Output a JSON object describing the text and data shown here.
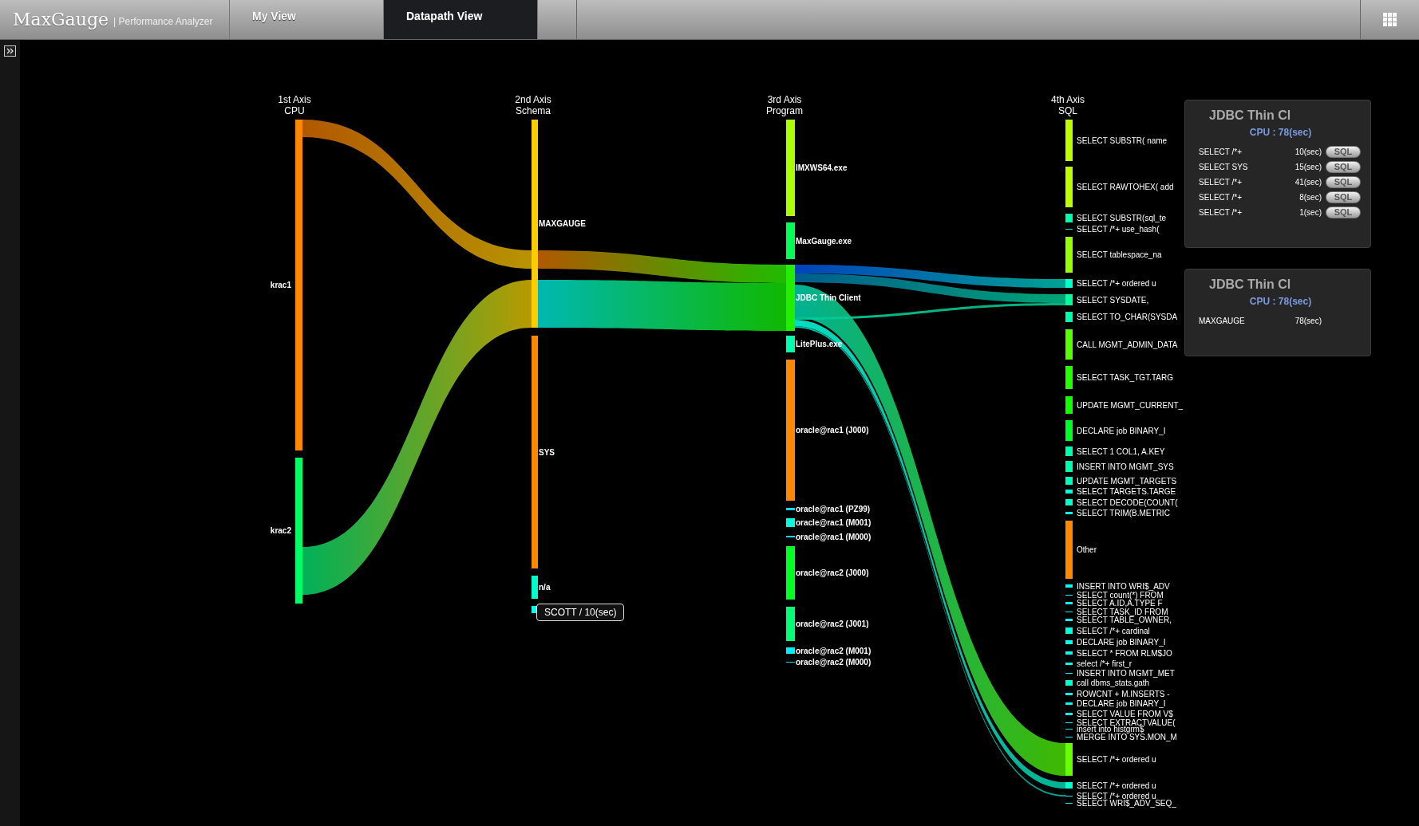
{
  "header": {
    "logo": "MaxGauge",
    "subtitle": "| Performance Analyzer",
    "tabs": [
      {
        "label": "My View",
        "selected": false
      },
      {
        "label": "Datapath View",
        "selected": true
      }
    ]
  },
  "diagram": {
    "axes": [
      {
        "title": "1st Axis",
        "subtitle": "CPU",
        "nodes": [
          {
            "label": "krac1",
            "color": "#ff8800"
          },
          {
            "label": "krac2",
            "color": "#00ff66"
          }
        ]
      },
      {
        "title": "2nd Axis",
        "subtitle": "Schema",
        "nodes": [
          {
            "label": "MAXGAUGE",
            "color": "#ffcc00"
          },
          {
            "label": "SYS",
            "color": "#ff8800"
          },
          {
            "label": "n/a",
            "color": "#00ffcc"
          },
          {
            "color": "#00ffee"
          }
        ]
      },
      {
        "title": "3rd Axis",
        "subtitle": "Program",
        "nodes": [
          {
            "label": "IMXWS64.exe",
            "color": "#aaff00"
          },
          {
            "label": "MaxGauge.exe",
            "color": "#00ff55"
          },
          {
            "label": "JDBC Thin Client",
            "color": "#22ee00"
          },
          {
            "label": "LitePlus.exe",
            "color": "#00ffaa"
          },
          {
            "label": "oracle@rac1 (J000)",
            "color": "#ff8800"
          },
          {
            "label": "oracle@rac1 (PZ99)",
            "color": "#00ddff"
          },
          {
            "label": "oracle@rac1 (M001)",
            "color": "#00ffdd"
          },
          {
            "label": "oracle@rac1 (M000)",
            "color": "#00ddff"
          },
          {
            "label": "oracle@rac2 (J000)",
            "color": "#00ff22"
          },
          {
            "label": "oracle@rac2 (J001)",
            "color": "#00ff77"
          },
          {
            "label": "oracle@rac2 (M001)",
            "color": "#00eeff"
          },
          {
            "label": "oracle@rac2 (M000)",
            "color": "#00ddff"
          }
        ]
      },
      {
        "title": "4th Axis",
        "subtitle": "SQL",
        "nodes": [
          {
            "label": "SELECT SUBSTR( name",
            "color": "#bbff00"
          },
          {
            "label": "SELECT RAWTOHEX( add",
            "color": "#bbff00"
          },
          {
            "label": "SELECT SUBSTR(sql_te",
            "color": "#00ffaa"
          },
          {
            "label": "SELECT /*+ use_hash(",
            "color": "#00ffcc"
          },
          {
            "label": "SELECT tablespace_na",
            "color": "#99ff00"
          },
          {
            "label": "SELECT /*+ ordered u",
            "color": "#00ffcc"
          },
          {
            "label": "SELECT SYSDATE,",
            "color": "#00ff99"
          },
          {
            "label": "SELECT TO_CHAR(SYSDA",
            "color": "#00ffaa"
          },
          {
            "label": "CALL MGMT_ADMIN_DATA",
            "color": "#55ff00"
          },
          {
            "label": "SELECT TASK_TGT.TARG",
            "color": "#22ff00"
          },
          {
            "label": "UPDATE MGMT_CURRENT_",
            "color": "#11ff00"
          },
          {
            "label": "DECLARE job BINARY_I",
            "color": "#00ff22"
          },
          {
            "label": "SELECT 1 COL1, A.KEY",
            "color": "#00ffaa"
          },
          {
            "label": "INSERT INTO MGMT_SYS",
            "color": "#00ffaa"
          },
          {
            "label": "UPDATE MGMT_TARGETS",
            "color": "#00ffbb"
          },
          {
            "label": "SELECT TARGETS.TARGE",
            "color": "#00ffdd"
          },
          {
            "label": "SELECT DECODE(COUNT(",
            "color": "#00ffcc"
          },
          {
            "label": "SELECT TRIM(B.METRIC",
            "color": "#00ffee"
          },
          {
            "label": "Other",
            "color": "#ff8800"
          },
          {
            "label": "INSERT INTO WRI$_ADV",
            "color": "#00ffee"
          },
          {
            "label": "SELECT count(*) FROM",
            "color": "#00ffee"
          },
          {
            "label": "SELECT A.ID,A.TYPE F",
            "color": "#00ffee"
          },
          {
            "label": "SELECT TASK_ID FROM",
            "color": "#00ffee"
          },
          {
            "label": "SELECT TABLE_OWNER,",
            "color": "#00ffee"
          },
          {
            "label": "SELECT /*+  cardinal",
            "color": "#00ffdd"
          },
          {
            "label": "DECLARE job BINARY_I",
            "color": "#00ffee"
          },
          {
            "label": "SELECT * FROM RLM$JO",
            "color": "#00ffee"
          },
          {
            "label": "select   /*+ first_r",
            "color": "#00ffee"
          },
          {
            "label": "INSERT INTO MGMT_MET",
            "color": "#00ffee"
          },
          {
            "label": "call dbms_stats.gath",
            "color": "#00ffcc"
          },
          {
            "label": "ROWCNT + M.INSERTS -",
            "color": "#00ffee"
          },
          {
            "label": "DECLARE job BINARY_I",
            "color": "#00ffee"
          },
          {
            "label": "SELECT VALUE FROM V$",
            "color": "#00ffee"
          },
          {
            "label": "SELECT EXTRACTVALUE(",
            "color": "#00ffee"
          },
          {
            "label": "insert into histgrm$",
            "color": "#00ffee"
          },
          {
            "label": "MERGE INTO SYS.MON_M",
            "color": "#00ffee"
          },
          {
            "label": "SELECT /*+ ordered u",
            "color": "#66ff00"
          },
          {
            "label": "SELECT /*+ ordered u",
            "color": "#00ffcc"
          },
          {
            "label": "SELECT /*+ ordered u",
            "color": "#00ffee"
          },
          {
            "label": "SELECT WRI$_ADV_SEQ_",
            "color": "#00ffee"
          }
        ]
      }
    ],
    "tooltip": "SCOTT / 10(sec)"
  },
  "panels": [
    {
      "title": "JDBC Thin Cl",
      "cpu": "CPU : 78(sec)",
      "rows": [
        {
          "label": "SELECT /*+",
          "value": "10(sec)",
          "button": "SQL"
        },
        {
          "label": "SELECT SYS",
          "value": "15(sec)",
          "button": "SQL"
        },
        {
          "label": "SELECT /*+",
          "value": "41(sec)",
          "button": "SQL"
        },
        {
          "label": "SELECT /*+",
          "value": "8(sec)",
          "button": "SQL"
        },
        {
          "label": "SELECT /*+",
          "value": "1(sec)",
          "button": "SQL"
        }
      ]
    },
    {
      "title": "JDBC Thin Cl",
      "cpu": "CPU : 78(sec)",
      "rows": [
        {
          "label": "MAXGAUGE",
          "value": "78(sec)"
        }
      ]
    }
  ]
}
